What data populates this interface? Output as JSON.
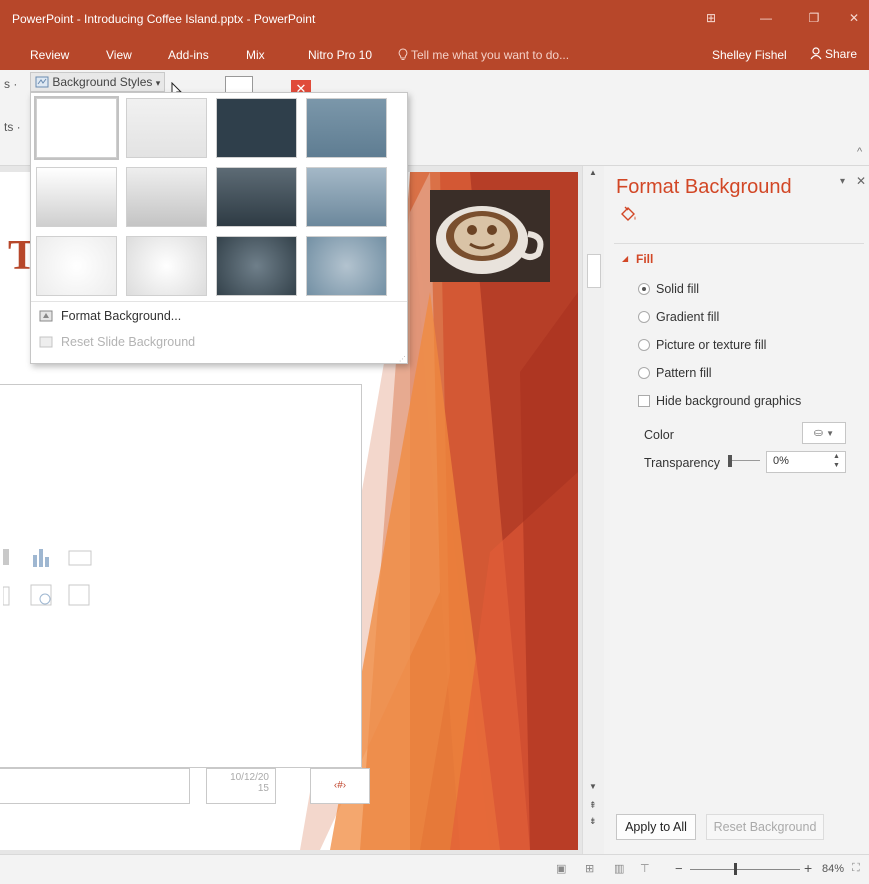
{
  "window": {
    "title": "PowerPoint - Introducing Coffee Island.pptx - PowerPoint",
    "controls": {
      "ribbon_display": "⊞",
      "minimize": "—",
      "restore": "❐",
      "close": "✕"
    }
  },
  "ribbon_tabs": [
    "Review",
    "View",
    "Add-ins",
    "Mix",
    "Nitro Pro 10"
  ],
  "tell_me": "Tell me what you want to do...",
  "user": "Shelley Fishel",
  "share_label": "Share",
  "ribbon": {
    "left_fragments": [
      "s ·",
      "ts ·"
    ],
    "background_styles_label": "Background Styles",
    "dropdown_arrow": "▾"
  },
  "gallery": {
    "swatches": [
      {
        "style": "white"
      },
      {
        "style": "light-gray"
      },
      {
        "style": "dark-slate"
      },
      {
        "style": "blue-gray"
      },
      {
        "style": "white-gradient"
      },
      {
        "style": "gray-gradient"
      },
      {
        "style": "dark-gradient"
      },
      {
        "style": "blue-gradient"
      },
      {
        "style": "white-radial"
      },
      {
        "style": "gray-radial"
      },
      {
        "style": "dark-radial"
      },
      {
        "style": "blue-radial"
      }
    ],
    "format_background_label": "Format Background...",
    "reset_label": "Reset Slide Background"
  },
  "slide": {
    "title_fragment": "T",
    "date_placeholder_line1": "10/12/20",
    "date_placeholder_line2": "15",
    "page_number": "‹#›"
  },
  "pane": {
    "title": "Format Background",
    "fill_section": "Fill",
    "options": [
      {
        "label": "Solid fill",
        "selected": true
      },
      {
        "label": "Gradient fill",
        "selected": false
      },
      {
        "label": "Picture or texture fill",
        "selected": false
      },
      {
        "label": "Pattern fill",
        "selected": false
      }
    ],
    "hide_graphics_label": "Hide background graphics",
    "color_label": "Color",
    "transparency_label": "Transparency",
    "transparency_value": "0%",
    "apply_all_label": "Apply to All",
    "reset_label": "Reset Background"
  },
  "status": {
    "zoom": "84%",
    "zoom_minus": "−",
    "zoom_plus": "+"
  },
  "colors": {
    "accent": "#b7472a",
    "pane_title": "#d24726",
    "slide_band": "#c0442b"
  }
}
